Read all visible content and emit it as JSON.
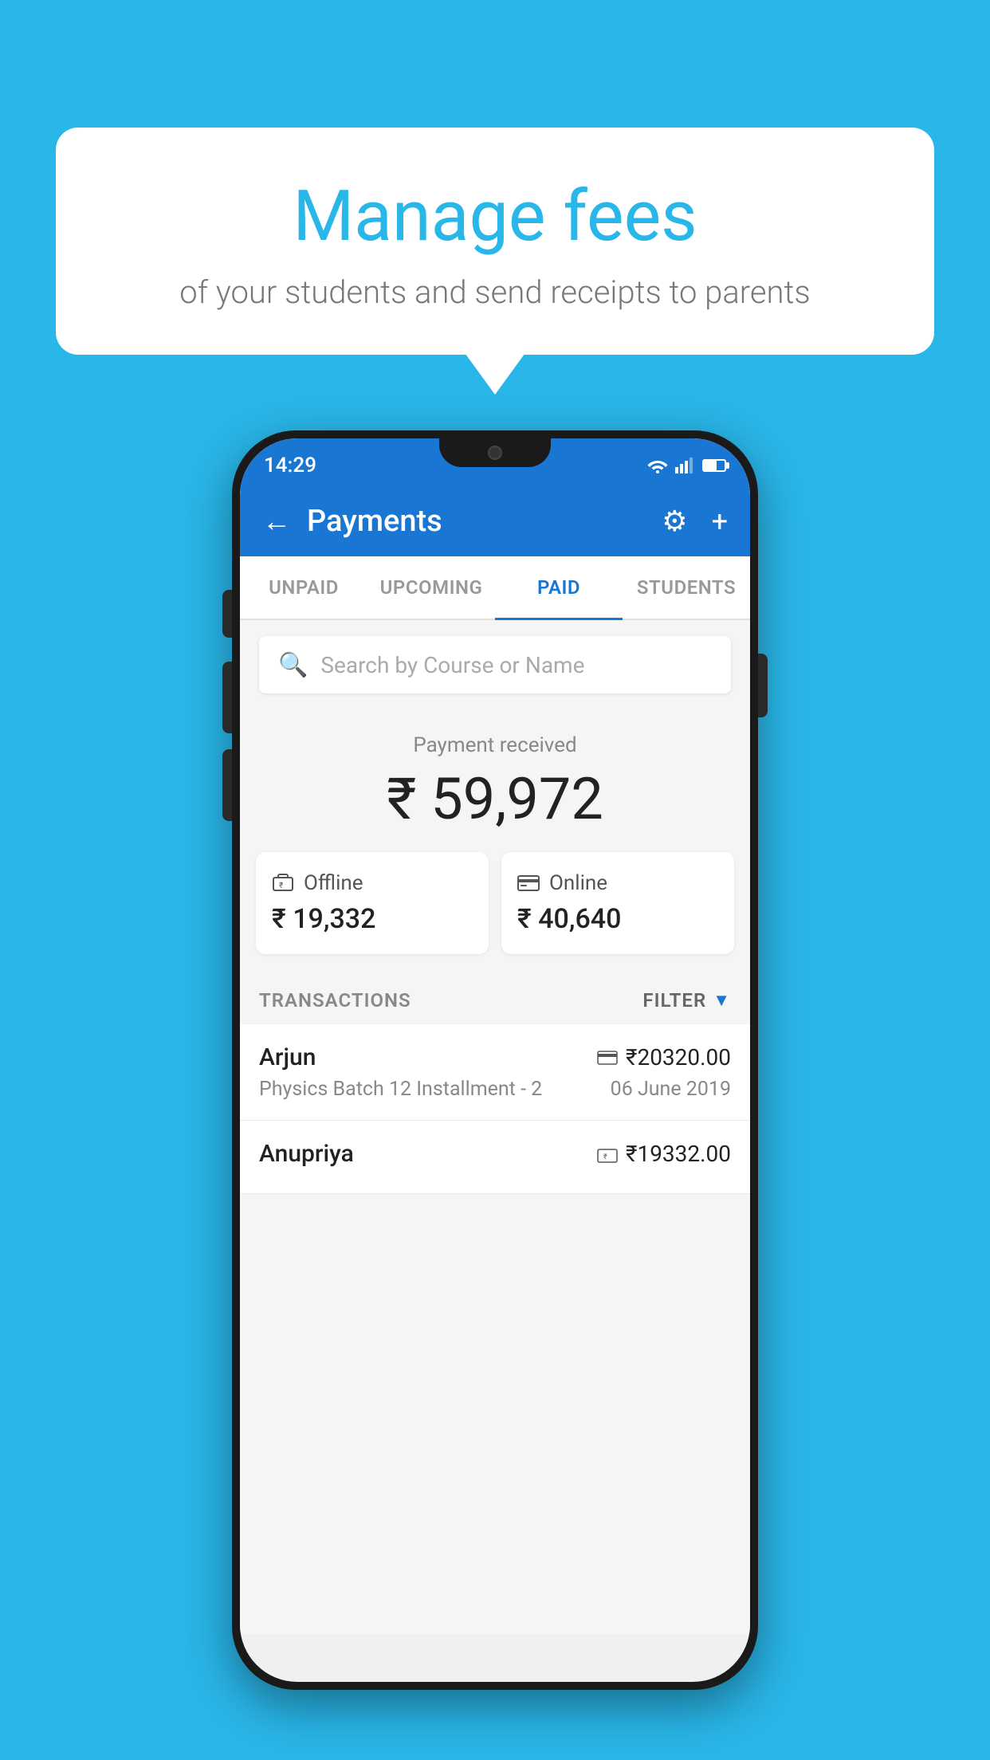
{
  "background_color": "#29b6e8",
  "speech_bubble": {
    "title": "Manage fees",
    "subtitle": "of your students and send receipts to parents"
  },
  "phone": {
    "status_bar": {
      "time": "14:29"
    },
    "header": {
      "title": "Payments",
      "back_label": "←",
      "settings_label": "⚙",
      "add_label": "+"
    },
    "tabs": [
      {
        "label": "UNPAID",
        "active": false
      },
      {
        "label": "UPCOMING",
        "active": false
      },
      {
        "label": "PAID",
        "active": true
      },
      {
        "label": "STUDENTS",
        "active": false
      }
    ],
    "search": {
      "placeholder": "Search by Course or Name"
    },
    "payment_received": {
      "label": "Payment received",
      "amount": "₹ 59,972"
    },
    "cards": [
      {
        "icon": "offline",
        "label": "Offline",
        "amount": "₹ 19,332"
      },
      {
        "icon": "online",
        "label": "Online",
        "amount": "₹ 40,640"
      }
    ],
    "transactions_label": "TRANSACTIONS",
    "filter_label": "FILTER",
    "transactions": [
      {
        "name": "Arjun",
        "payment_type": "card",
        "amount": "₹20320.00",
        "course": "Physics Batch 12 Installment - 2",
        "date": "06 June 2019"
      },
      {
        "name": "Anupriya",
        "payment_type": "offline",
        "amount": "₹19332.00",
        "course": "",
        "date": ""
      }
    ]
  }
}
